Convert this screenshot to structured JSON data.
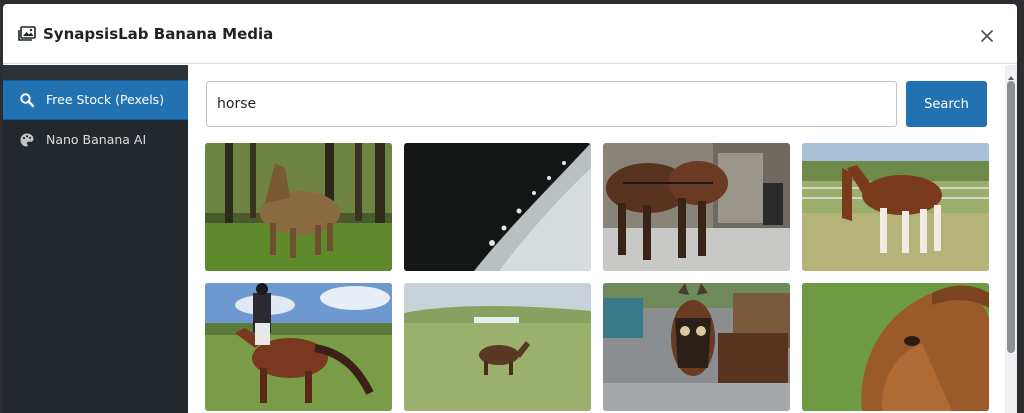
{
  "modal": {
    "title": "SynapsisLab Banana Media",
    "header_icon": "media-gallery-icon",
    "close_icon": "close-icon"
  },
  "sidebar": {
    "items": [
      {
        "label": "Free Stock (Pexels)",
        "icon": "search-icon",
        "active": true
      },
      {
        "label": "Nano Banana AI",
        "icon": "palette-icon",
        "active": false
      }
    ]
  },
  "search": {
    "value": "horse",
    "button_label": "Search"
  },
  "colors": {
    "accent": "#2271b1",
    "sidebar_bg": "#23282d"
  },
  "results": [
    {
      "subject": "horse-in-forest-photo"
    },
    {
      "subject": "horse-coat-closeup-photo"
    },
    {
      "subject": "draft-horses-street-photo"
    },
    {
      "subject": "horse-in-paddock-photo"
    },
    {
      "subject": "rider-on-horse-photo"
    },
    {
      "subject": "horse-running-meadow-photo"
    },
    {
      "subject": "carriage-horses-photo"
    },
    {
      "subject": "horse-head-closeup-photo"
    }
  ]
}
